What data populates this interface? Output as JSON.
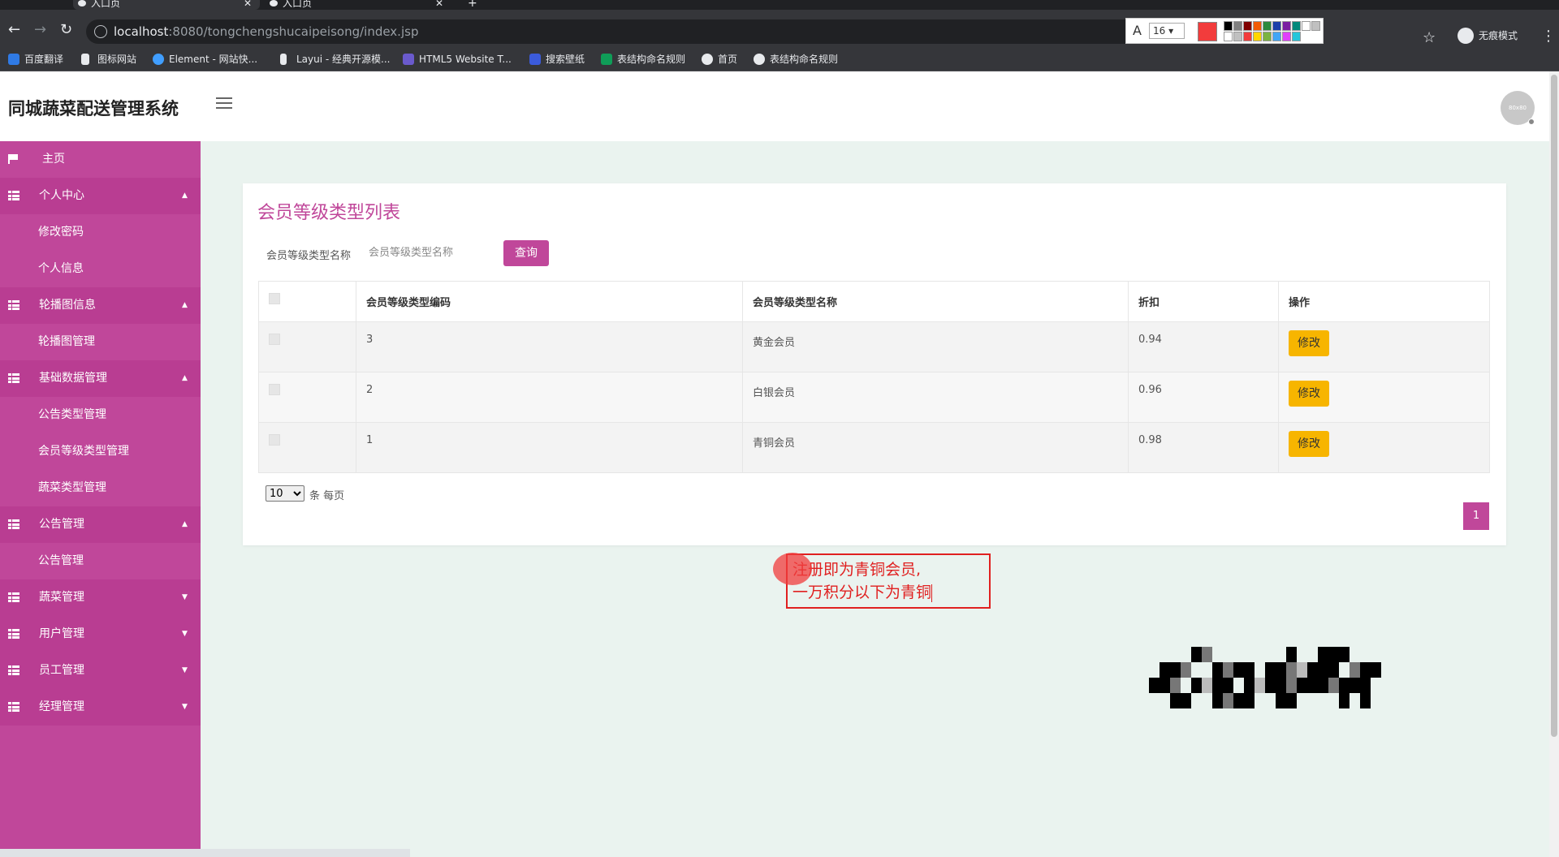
{
  "browser": {
    "tabs": [
      {
        "title": "入口页"
      },
      {
        "title": "入口页"
      }
    ],
    "url_host": "localhost",
    "url_rest": ":8080/tongchengshucaipeisong/index.jsp",
    "incognito_label": "无痕模式",
    "bookmarks": [
      {
        "label": "百度翻译"
      },
      {
        "label": "图标网站"
      },
      {
        "label": "Element - 网站快..."
      },
      {
        "label": "Layui - 经典开源模..."
      },
      {
        "label": "HTML5 Website T..."
      },
      {
        "label": "搜索壁纸"
      },
      {
        "label": "表结构命名规则"
      },
      {
        "label": "首页"
      },
      {
        "label": "表结构命名规则"
      }
    ]
  },
  "annotation_tool": {
    "font_size": "16",
    "current_color": "#f23c3c"
  },
  "app": {
    "title": "同城蔬菜配送管理系统",
    "avatar_text": "80x80"
  },
  "sidebar": {
    "items": [
      {
        "label": "主页",
        "type": "top",
        "icon": "flag-icon"
      },
      {
        "label": "个人中心",
        "type": "parent",
        "icon": "grid-icon",
        "arrow": "▲"
      },
      {
        "label": "修改密码",
        "type": "child"
      },
      {
        "label": "个人信息",
        "type": "child"
      },
      {
        "label": "轮播图信息",
        "type": "parent",
        "icon": "grid-icon",
        "arrow": "▲"
      },
      {
        "label": "轮播图管理",
        "type": "child"
      },
      {
        "label": "基础数据管理",
        "type": "parent",
        "icon": "grid-icon",
        "arrow": "▲"
      },
      {
        "label": "公告类型管理",
        "type": "child"
      },
      {
        "label": "会员等级类型管理",
        "type": "child"
      },
      {
        "label": "蔬菜类型管理",
        "type": "child"
      },
      {
        "label": "公告管理",
        "type": "parent",
        "icon": "grid-icon",
        "arrow": "▲"
      },
      {
        "label": "公告管理",
        "type": "child"
      },
      {
        "label": "蔬菜管理",
        "type": "parent",
        "icon": "grid-icon",
        "arrow": "▼"
      },
      {
        "label": "用户管理",
        "type": "parent",
        "icon": "grid-icon",
        "arrow": "▼"
      },
      {
        "label": "员工管理",
        "type": "parent",
        "icon": "grid-icon",
        "arrow": "▼"
      },
      {
        "label": "经理管理",
        "type": "parent",
        "icon": "grid-icon",
        "arrow": "▼"
      }
    ]
  },
  "main": {
    "title": "会员等级类型列表",
    "search_label": "会员等级类型名称",
    "search_placeholder": "会员等级类型名称",
    "query_button": "查询",
    "table": {
      "headers": [
        "会员等级类型编码",
        "会员等级类型名称",
        "折扣",
        "操作"
      ],
      "rows": [
        {
          "code": "3",
          "name": "黄金会员",
          "discount": "0.94",
          "action": "修改"
        },
        {
          "code": "2",
          "name": "白银会员",
          "discount": "0.96",
          "action": "修改"
        },
        {
          "code": "1",
          "name": "青铜会员",
          "discount": "0.98",
          "action": "修改"
        }
      ]
    },
    "page_size": "10",
    "page_size_suffix": "条 每页",
    "current_page": "1"
  },
  "annotation": {
    "line1": "注册即为青铜会员,",
    "line2": "一万积分以下为青铜"
  }
}
